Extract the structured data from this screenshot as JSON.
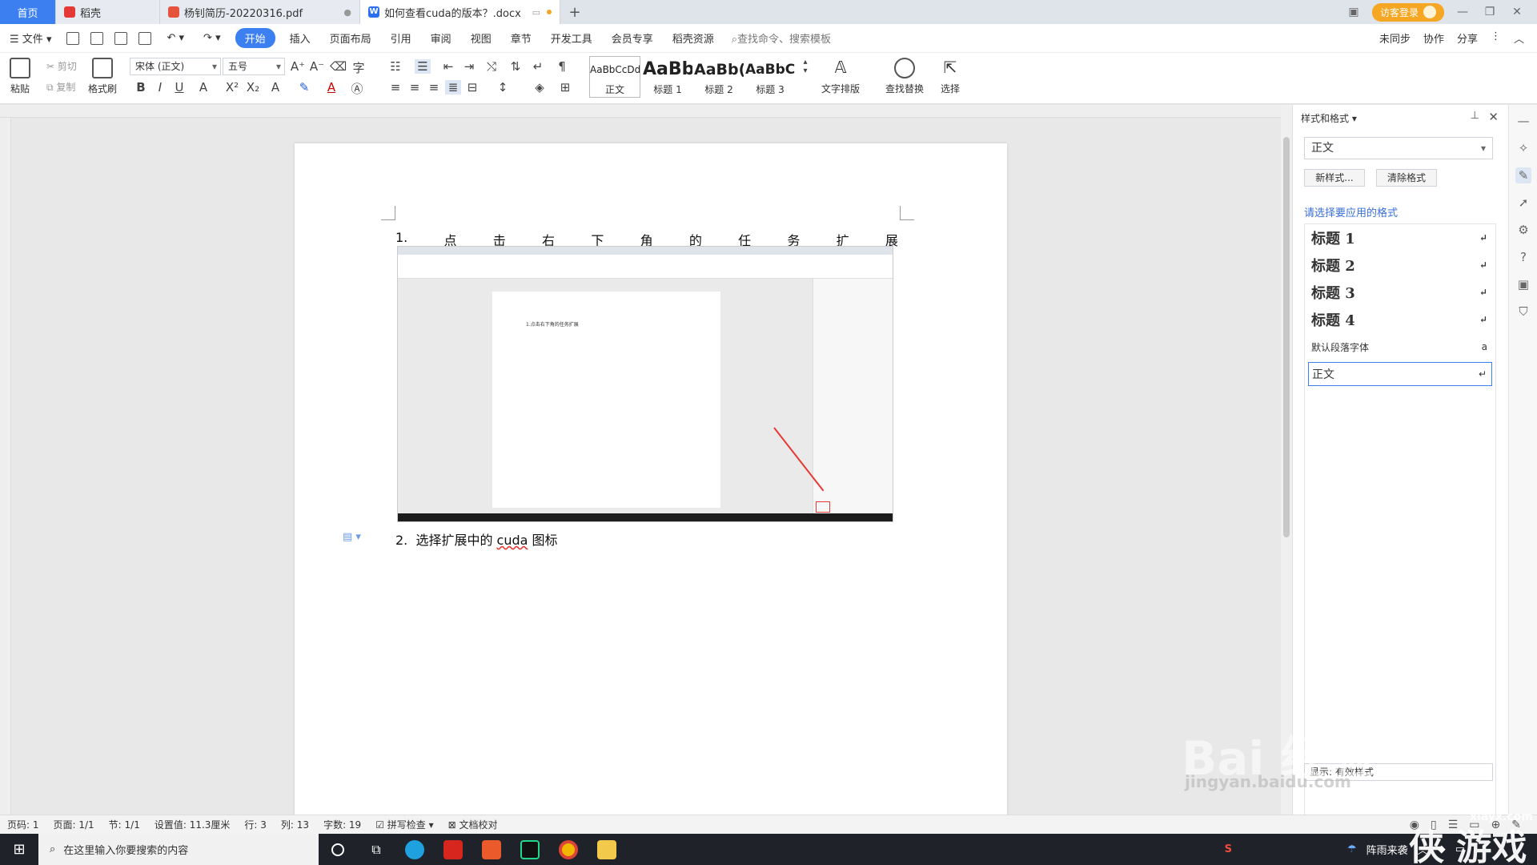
{
  "tabs": {
    "home": "首页",
    "t2": "稻壳",
    "t3": "杨钊简历-20220316.pdf",
    "active": "如何查看cuda的版本？.docx"
  },
  "titlebar": {
    "visitor": "访客登录"
  },
  "menu": {
    "file": "文件",
    "start": "开始",
    "items": [
      "插入",
      "页面布局",
      "引用",
      "审阅",
      "视图",
      "章节",
      "开发工具",
      "会员专享",
      "稻壳资源"
    ],
    "search": "查找命令、搜索模板",
    "right": [
      "未同步",
      "协作",
      "分享"
    ]
  },
  "ribbon": {
    "paste": "粘贴",
    "cut": "剪切",
    "copy": "复制",
    "format_painter": "格式刷",
    "font_name": "宋体 (正文)",
    "font_size": "五号",
    "styles": [
      {
        "preview": "AaBbCcDd",
        "label": "正文"
      },
      {
        "preview": "AaBb",
        "label": "标题 1"
      },
      {
        "preview": "AaBb(",
        "label": "标题 2"
      },
      {
        "preview": "AaBbC(",
        "label": "标题 3"
      }
    ],
    "text_layout": "文字排版",
    "find_replace": "查找替换",
    "select": "选择"
  },
  "document": {
    "para1_num": "1.",
    "para1_chars": [
      "点",
      "击",
      "右",
      "下",
      "角",
      "的",
      "任",
      "务",
      "扩",
      "展"
    ],
    "embedded_caption": "1.点击右下角的任务扩展",
    "para2_num": "2.",
    "para2_pre": "选择扩展中的 ",
    "para2_word": "cuda",
    "para2_post": " 图标"
  },
  "panel": {
    "title": "样式和格式",
    "current_style": "正文",
    "new_style": "新样式...",
    "clear_format": "清除格式",
    "hint": "请选择要应用的格式",
    "styles": [
      "标题 1",
      "标题 2",
      "标题 3",
      "标题 4",
      "默认段落字体",
      "正文"
    ],
    "footer": "显示: 有效样式"
  },
  "statusbar": {
    "page_no": "页码: 1",
    "pages": "页面: 1/1",
    "section": "节: 1/1",
    "setting": "设置值: 11.3厘米",
    "row": "行: 3",
    "col": "列: 13",
    "words": "字数: 19",
    "spell": "拼写检查",
    "proof": "文档校对"
  },
  "taskbar": {
    "search": "在这里输入你要搜索的内容",
    "weather": "阵雨来袭"
  },
  "watermark": {
    "baidu": "Bai 经验",
    "url": "jingyan.baidu.com",
    "xiayx": "xiayx.com",
    "game": "侠 游戏"
  }
}
